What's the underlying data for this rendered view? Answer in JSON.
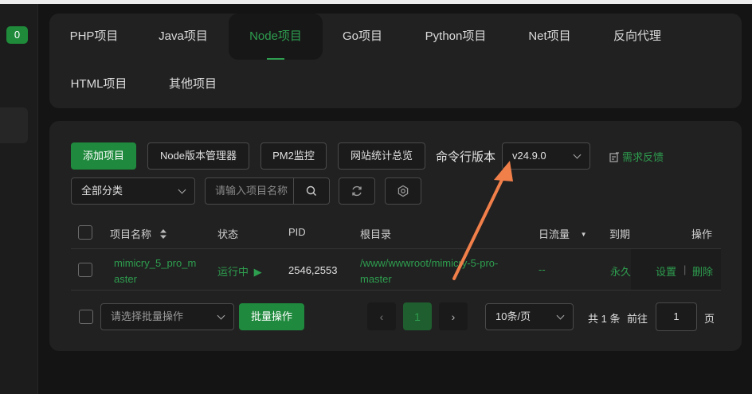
{
  "sidebar": {
    "badge": "0"
  },
  "tabs": [
    {
      "label": "PHP项目"
    },
    {
      "label": "Java项目"
    },
    {
      "label": "Node项目"
    },
    {
      "label": "Go项目"
    },
    {
      "label": "Python项目"
    },
    {
      "label": "Net项目"
    },
    {
      "label": "反向代理"
    },
    {
      "label": "HTML项目"
    },
    {
      "label": "其他项目"
    }
  ],
  "toolbar": {
    "add_project": "添加项目",
    "node_version_manager": "Node版本管理器",
    "pm2_monitor": "PM2监控",
    "site_stats": "网站统计总览",
    "cli_version_label": "命令行版本",
    "cli_version_value": "v24.9.0",
    "feedback": "需求反馈",
    "category_select": "全部分类",
    "search_placeholder": "请输入项目名称"
  },
  "table": {
    "headers": {
      "name": "项目名称",
      "status": "状态",
      "pid": "PID",
      "root": "根目录",
      "traffic": "日流量",
      "expire": "到期",
      "ops": "操作"
    },
    "rows": [
      {
        "name_line1": "mimicry_5_pro_m",
        "name_line2": "aster",
        "status": "运行中",
        "pid": "2546,2553",
        "root_line1": "/www/wwwroot/mimicry-5-pro-",
        "root_line2": "master",
        "traffic": "--",
        "expire": "永久",
        "op_settings": "设置",
        "op_sep": "|",
        "op_delete": "删除"
      }
    ]
  },
  "footer": {
    "batch_select": "请选择批量操作",
    "batch_button": "批量操作",
    "current_page": "1",
    "page_size": "10条/页",
    "total": "共 1 条",
    "goto_label": "前往",
    "goto_value": "1",
    "page_unit": "页"
  },
  "colors": {
    "accent": "#2e9e4f",
    "primary_button": "#1f8a3d",
    "annotation_arrow": "#f07f4a"
  }
}
